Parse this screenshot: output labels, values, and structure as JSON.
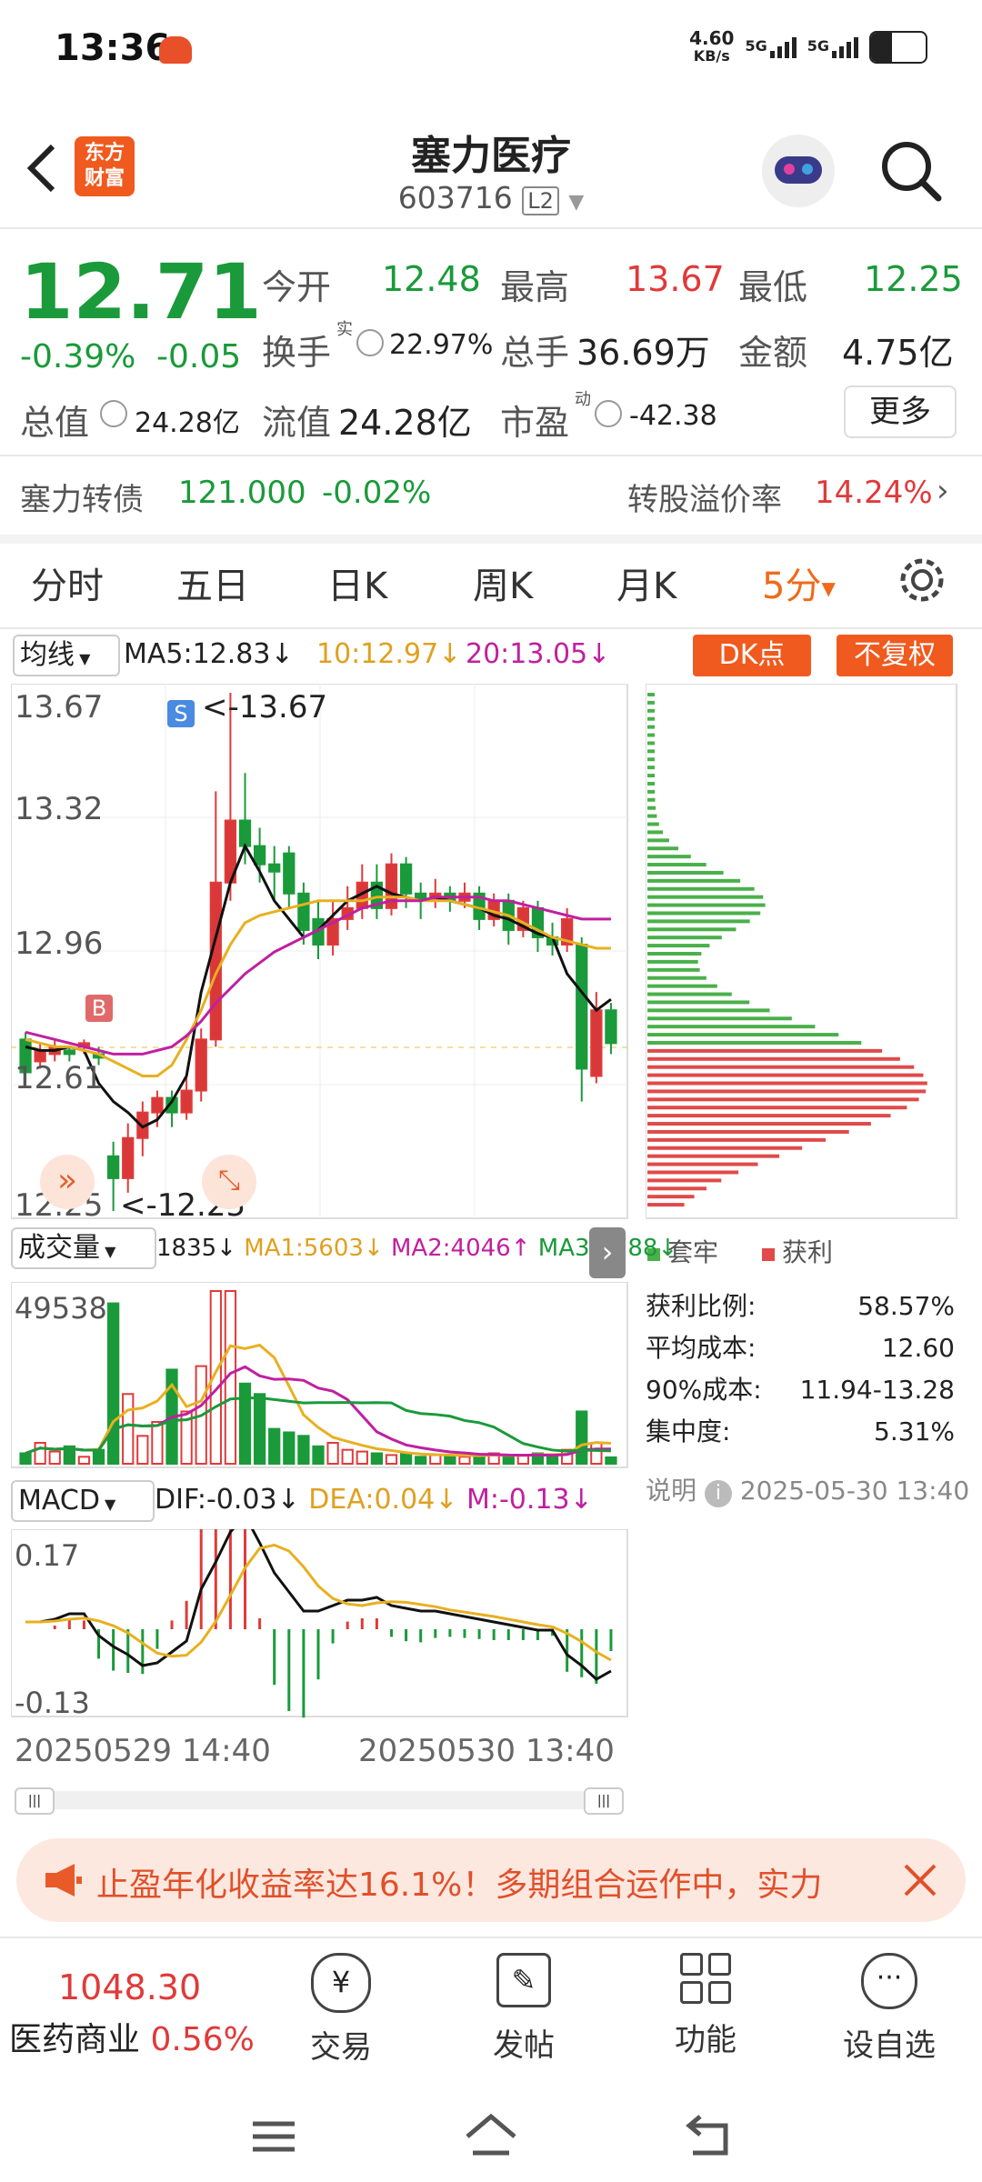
{
  "status": {
    "time": "13:36",
    "net_speed": "4.60",
    "net_unit": "KB/s",
    "sig1": "5G",
    "sig2": "5G"
  },
  "header": {
    "title": "塞力医疗",
    "code": "603716",
    "level": "L2",
    "logo_line1": "东方",
    "logo_line2": "财富"
  },
  "quote": {
    "price": "12.71",
    "change_pct": "-0.39%",
    "change": "-0.05",
    "open_label": "今开",
    "open": "12.48",
    "high_label": "最高",
    "high": "13.67",
    "low_label": "最低",
    "low": "12.25",
    "turnover_label": "换手",
    "turnover_tag": "实",
    "turnover": "22.97%",
    "vol_label": "总手",
    "vol": "36.69万",
    "amount_label": "金额",
    "amount": "4.75亿",
    "mktcap_label": "总值",
    "mktcap": "24.28亿",
    "float_label": "流值",
    "float": "24.28亿",
    "pe_label": "市盈",
    "pe_tag": "动",
    "pe": "-42.38",
    "more_label": "更多"
  },
  "bond": {
    "name": "塞力转债",
    "price": "121.000",
    "change": "-0.02%",
    "premium_label": "转股溢价率",
    "premium": "14.24%"
  },
  "tabs": [
    "分时",
    "五日",
    "日K",
    "周K",
    "月K",
    "5分"
  ],
  "ma_row": {
    "selector": "均线",
    "ma5": "MA5:12.83",
    "ma10": "10:12.97",
    "ma20": "20:13.05",
    "dk_btn": "DK点",
    "fq_btn": "不复权"
  },
  "chart_labels": {
    "y_top": "13.67",
    "y2": "13.32",
    "y3": "12.96",
    "y4": "12.61",
    "y_bot": "12.25",
    "high_mark": "<-13.67",
    "low_mark": "<-12.25",
    "s_tag": "S",
    "b_tag": "B"
  },
  "vol_row": {
    "selector": "成交量",
    "val": "1835",
    "ma1": "MA1:5603",
    "ma2": "MA2:4046",
    "ma3": "MA3:3788",
    "y_top": "49538"
  },
  "macd_row": {
    "selector": "MACD",
    "dif": "DIF:-0.03",
    "dea": "DEA:0.04",
    "m": "M:-0.13",
    "y_top": "0.17",
    "y_bot": "-0.13"
  },
  "time_axis": {
    "start": "20250529 14:40",
    "end": "20250530 13:40"
  },
  "chip": {
    "legend_trapped": "套牢",
    "legend_profit": "获利",
    "rows": [
      {
        "label": "获利比例:",
        "value": "58.57%"
      },
      {
        "label": "平均成本:",
        "value": "12.60"
      },
      {
        "label": "90%成本:",
        "value": "11.94-13.28"
      },
      {
        "label": "集中度:",
        "value": "5.31%"
      }
    ],
    "note_label": "说明",
    "note_date": "2025-05-30 13:40"
  },
  "ad": {
    "text": "止盈年化收益率达16.1%！多期组合运作中，实力"
  },
  "bottom_nav": {
    "index_value": "1048.30",
    "index_name": "医药商业",
    "index_change": "0.56%",
    "items": [
      "交易",
      "发帖",
      "功能",
      "设自选"
    ]
  },
  "colors": {
    "up": "#e03a3a",
    "down": "#1a9a3a",
    "accent": "#f06a1a"
  },
  "chart_data": {
    "type": "candlestick",
    "title": "5分",
    "ylim": [
      12.25,
      13.67
    ],
    "candles": [
      {
        "o": 12.72,
        "c": 12.63,
        "h": 12.74,
        "l": 12.6
      },
      {
        "o": 12.66,
        "c": 12.69,
        "h": 12.71,
        "l": 12.64
      },
      {
        "o": 12.68,
        "c": 12.7,
        "h": 12.72,
        "l": 12.66
      },
      {
        "o": 12.69,
        "c": 12.68,
        "h": 12.7,
        "l": 12.66
      },
      {
        "o": 12.7,
        "c": 12.71,
        "h": 12.72,
        "l": 12.68
      },
      {
        "o": 12.68,
        "c": 12.67,
        "h": 12.7,
        "l": 12.65
      },
      {
        "o": 12.4,
        "c": 12.34,
        "h": 12.44,
        "l": 12.25
      },
      {
        "o": 12.34,
        "c": 12.45,
        "h": 12.49,
        "l": 12.3
      },
      {
        "o": 12.45,
        "c": 12.52,
        "h": 12.55,
        "l": 12.4
      },
      {
        "o": 12.52,
        "c": 12.56,
        "h": 12.58,
        "l": 12.48
      },
      {
        "o": 12.56,
        "c": 12.52,
        "h": 12.58,
        "l": 12.48
      },
      {
        "o": 12.52,
        "c": 12.58,
        "h": 12.62,
        "l": 12.5
      },
      {
        "o": 12.58,
        "c": 12.72,
        "h": 12.75,
        "l": 12.55
      },
      {
        "o": 12.72,
        "c": 13.15,
        "h": 13.4,
        "l": 12.7
      },
      {
        "o": 13.15,
        "c": 13.32,
        "h": 13.67,
        "l": 13.1
      },
      {
        "o": 13.32,
        "c": 13.25,
        "h": 13.45,
        "l": 13.2
      },
      {
        "o": 13.25,
        "c": 13.2,
        "h": 13.3,
        "l": 13.15
      },
      {
        "o": 13.2,
        "c": 13.18,
        "h": 13.25,
        "l": 13.1
      },
      {
        "o": 13.23,
        "c": 13.12,
        "h": 13.25,
        "l": 13.08
      },
      {
        "o": 13.12,
        "c": 13.02,
        "h": 13.15,
        "l": 12.98
      },
      {
        "o": 13.05,
        "c": 12.98,
        "h": 13.1,
        "l": 12.94
      },
      {
        "o": 12.98,
        "c": 13.05,
        "h": 13.1,
        "l": 12.95
      },
      {
        "o": 13.05,
        "c": 13.08,
        "h": 13.14,
        "l": 13.02
      },
      {
        "o": 13.08,
        "c": 13.15,
        "h": 13.2,
        "l": 13.05
      },
      {
        "o": 13.15,
        "c": 13.08,
        "h": 13.2,
        "l": 13.05
      },
      {
        "o": 13.08,
        "c": 13.2,
        "h": 13.23,
        "l": 13.06
      },
      {
        "o": 13.2,
        "c": 13.12,
        "h": 13.22,
        "l": 13.08
      },
      {
        "o": 13.12,
        "c": 13.1,
        "h": 13.15,
        "l": 13.05
      },
      {
        "o": 13.1,
        "c": 13.12,
        "h": 13.16,
        "l": 13.08
      },
      {
        "o": 13.12,
        "c": 13.1,
        "h": 13.14,
        "l": 13.07
      },
      {
        "o": 13.1,
        "c": 13.12,
        "h": 13.15,
        "l": 13.08
      },
      {
        "o": 13.12,
        "c": 13.05,
        "h": 13.14,
        "l": 13.02
      },
      {
        "o": 13.05,
        "c": 13.1,
        "h": 13.12,
        "l": 13.03
      },
      {
        "o": 13.1,
        "c": 13.02,
        "h": 13.12,
        "l": 12.98
      },
      {
        "o": 13.02,
        "c": 13.08,
        "h": 13.1,
        "l": 13.0
      },
      {
        "o": 13.08,
        "c": 13.0,
        "h": 13.1,
        "l": 12.96
      },
      {
        "o": 13.0,
        "c": 12.98,
        "h": 13.04,
        "l": 12.95
      },
      {
        "o": 12.98,
        "c": 13.05,
        "h": 13.08,
        "l": 12.96
      },
      {
        "o": 12.98,
        "c": 12.64,
        "h": 13.0,
        "l": 12.55
      },
      {
        "o": 12.62,
        "c": 12.8,
        "h": 12.85,
        "l": 12.6
      },
      {
        "o": 12.8,
        "c": 12.71,
        "h": 12.82,
        "l": 12.68
      }
    ],
    "ma5": [
      12.7,
      12.69,
      12.69,
      12.7,
      12.69,
      12.6,
      12.55,
      12.52,
      12.48,
      12.5,
      12.55,
      12.62,
      12.85,
      13.0,
      13.15,
      13.25,
      13.18,
      13.1,
      13.05,
      13.0,
      13.02,
      13.06,
      13.1,
      13.12,
      13.14,
      13.12,
      13.11,
      13.1,
      13.11,
      13.1,
      13.09,
      13.08,
      13.06,
      13.05,
      13.03,
      13.01,
      13.0,
      12.9,
      12.85,
      12.8,
      12.83
    ],
    "ma10": [
      12.72,
      12.71,
      12.7,
      12.7,
      12.69,
      12.68,
      12.66,
      12.64,
      12.62,
      12.62,
      12.65,
      12.72,
      12.8,
      12.9,
      12.98,
      13.04,
      13.06,
      13.07,
      13.08,
      13.09,
      13.1,
      13.1,
      13.1,
      13.1,
      13.11,
      13.11,
      13.11,
      13.1,
      13.1,
      13.1,
      13.09,
      13.08,
      13.07,
      13.06,
      13.04,
      13.02,
      13.0,
      12.99,
      12.98,
      12.97,
      12.97
    ],
    "ma20": [
      12.74,
      12.73,
      12.72,
      12.71,
      12.7,
      12.69,
      12.68,
      12.68,
      12.68,
      12.69,
      12.7,
      12.73,
      12.77,
      12.82,
      12.86,
      12.9,
      12.93,
      12.96,
      12.98,
      13.0,
      13.02,
      13.04,
      13.06,
      13.08,
      13.09,
      13.1,
      13.1,
      13.1,
      13.11,
      13.11,
      13.11,
      13.11,
      13.1,
      13.1,
      13.09,
      13.08,
      13.07,
      13.06,
      13.05,
      13.05,
      13.05
    ]
  }
}
